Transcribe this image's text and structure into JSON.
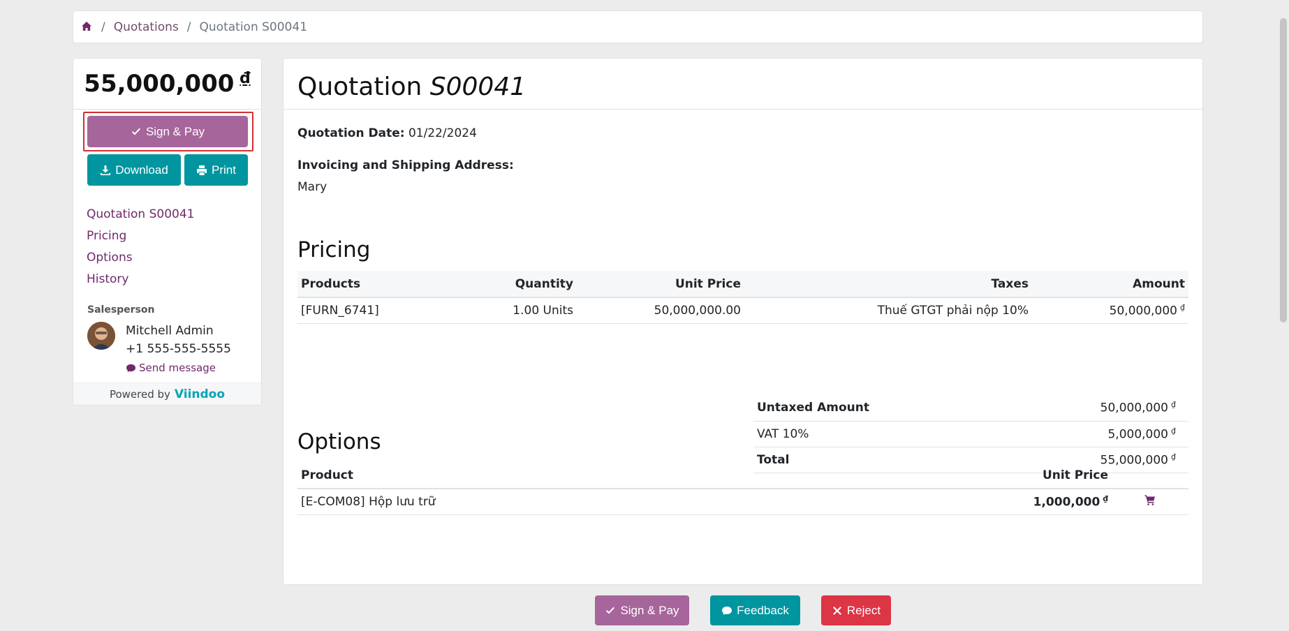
{
  "breadcrumb": {
    "link": "Quotations",
    "current": "Quotation S00041"
  },
  "sidebar": {
    "amount": "55,000,000",
    "currency": "₫",
    "sign_pay_label": "Sign & Pay",
    "download_label": "Download",
    "print_label": "Print",
    "nav": [
      "Quotation S00041",
      "Pricing",
      "Options",
      "History"
    ],
    "salesperson_label": "Salesperson",
    "salesperson_name": "Mitchell Admin",
    "salesperson_phone": "+1 555-555-5555",
    "send_message_label": "Send message",
    "powered_by": "Powered by",
    "brand": "Viindoo"
  },
  "main": {
    "title_prefix": "Quotation",
    "title_number": "S00041",
    "date_label": "Quotation Date:",
    "date_value": "01/22/2024",
    "address_label": "Invoicing and Shipping Address:",
    "address_value": "Mary",
    "pricing_heading": "Pricing",
    "pricing_columns": [
      "Products",
      "Quantity",
      "Unit Price",
      "Taxes",
      "Amount"
    ],
    "pricing_rows": [
      {
        "product": "[FURN_6741]",
        "quantity": "1.00 Units",
        "unit_price": "50,000,000.00",
        "taxes": "Thuế GTGT phải nộp 10%",
        "amount": "50,000,000"
      }
    ],
    "totals": {
      "untaxed_label": "Untaxed Amount",
      "untaxed_value": "50,000,000",
      "vat_label": "VAT 10%",
      "vat_value": "5,000,000",
      "total_label": "Total",
      "total_value": "55,000,000"
    },
    "options_heading": "Options",
    "options_columns": [
      "Product",
      "Unit Price"
    ],
    "options_rows": [
      {
        "product": "[E-COM08] Hộp lưu trữ",
        "unit_price": "1,000,000"
      }
    ]
  },
  "footer": {
    "sign_pay_label": "Sign & Pay",
    "feedback_label": "Feedback",
    "reject_label": "Reject"
  },
  "colors": {
    "primary": "#a6659b",
    "teal": "#00959f",
    "danger": "#dc3545",
    "link": "#71296c"
  }
}
